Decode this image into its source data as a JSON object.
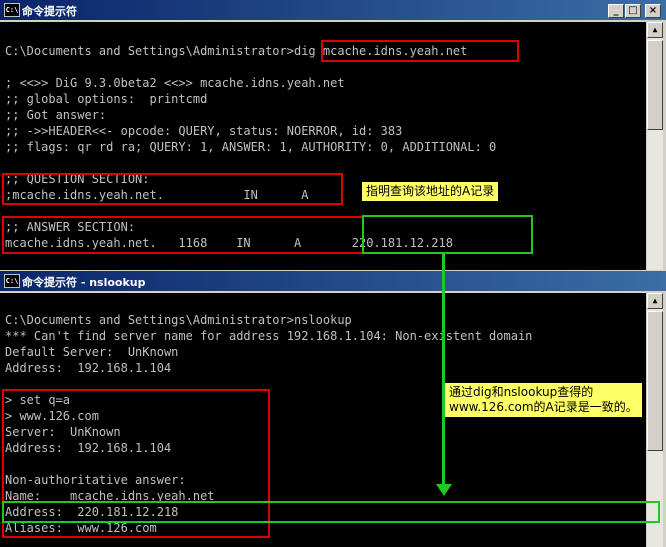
{
  "window1": {
    "title": "命令提示符",
    "lines": [
      "C:\\Documents and Settings\\Administrator>dig mcache.idns.yeah.net",
      "",
      "; <<>> DiG 9.3.0beta2 <<>> mcache.idns.yeah.net",
      ";; global options:  printcmd",
      ";; Got answer:",
      ";; ->>HEADER<<- opcode: QUERY, status: NOERROR, id: 383",
      ";; flags: qr rd ra; QUERY: 1, ANSWER: 1, AUTHORITY: 0, ADDITIONAL: 0",
      "",
      ";; QUESTION SECTION:",
      ";mcache.idns.yeah.net.           IN      A",
      "",
      ";; ANSWER SECTION:",
      "mcache.idns.yeah.net.   1168    IN      A       220.181.12.218"
    ]
  },
  "window2": {
    "title": "命令提示符 - nslookup",
    "lines": [
      "C:\\Documents and Settings\\Administrator>nslookup",
      "*** Can't find server name for address 192.168.1.104: Non-existent domain",
      "Default Server:  UnKnown",
      "Address:  192.168.1.104",
      "",
      "> set q=a",
      "> www.126.com",
      "Server:  UnKnown",
      "Address:  192.168.1.104",
      "",
      "Non-authoritative answer:",
      "Name:    mcache.idns.yeah.net",
      "Address:  220.181.12.218",
      "Aliases:  www.126.com"
    ]
  },
  "annotations": {
    "note1": "指明查询该地址的A记录",
    "note2_line1": "通过dig和nslookup查得的",
    "note2_line2": "www.126.com的A记录是一致的。"
  },
  "window_buttons": {
    "minimize": "_",
    "maximize": "□",
    "close": "×"
  },
  "icons": {
    "app": "console-icon"
  },
  "colors": {
    "console_bg": "#000000",
    "console_text": "#c0c0c0",
    "titlebar": "#0a246a",
    "highlight_red": "#e00000",
    "highlight_green": "#22c822",
    "note_bg": "#ffff66"
  }
}
